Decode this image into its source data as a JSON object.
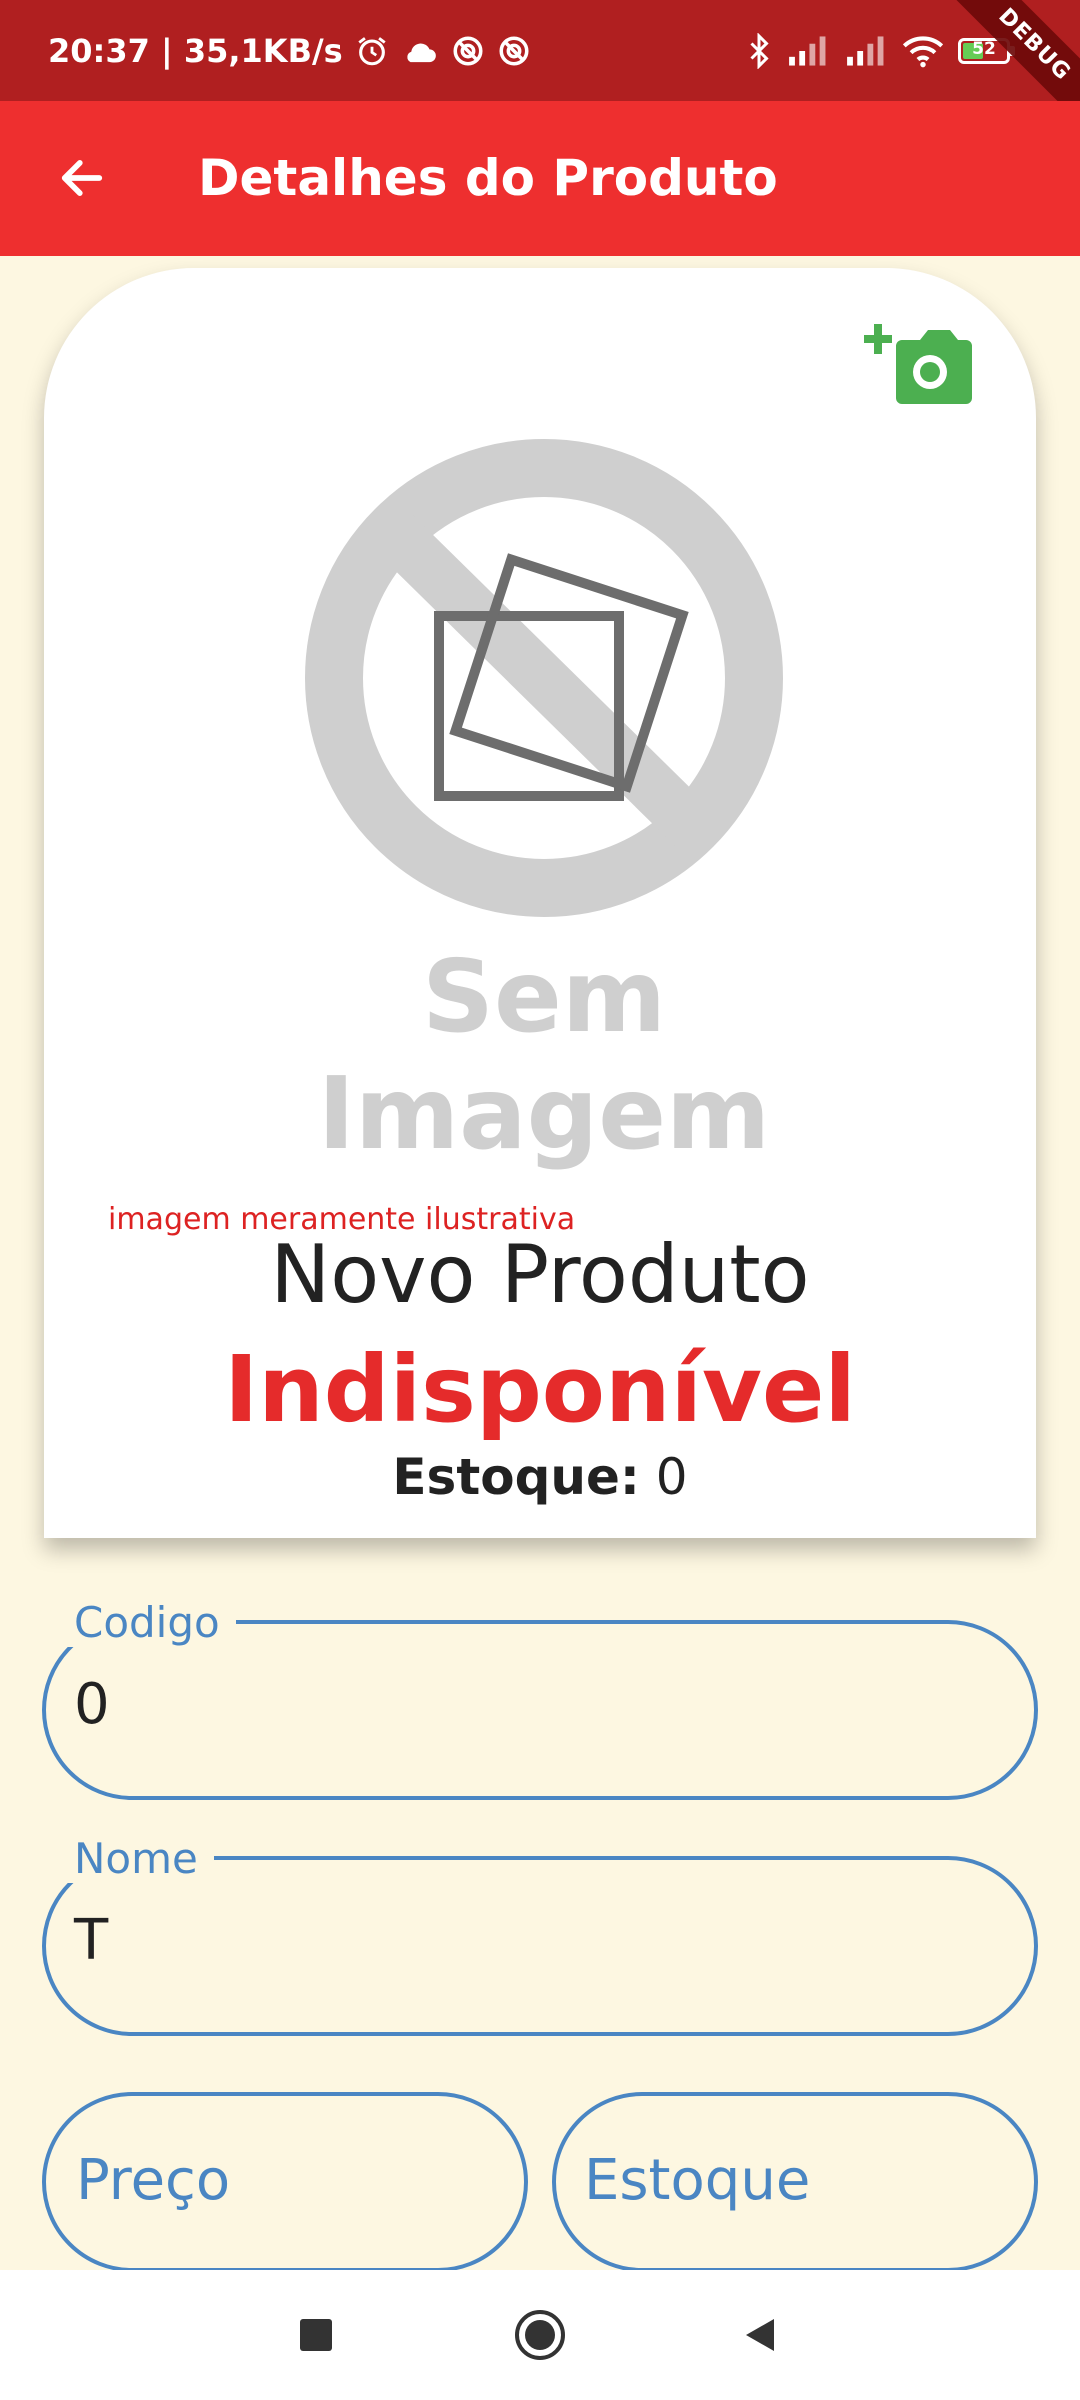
{
  "status_bar": {
    "time_speed": "20:37 | 35,1KB/s",
    "battery_level": "52",
    "battery_fraction": 0.52,
    "debug_label": "DEBUG"
  },
  "app_bar": {
    "title": "Detalhes do Produto",
    "back_icon": "arrow-left-icon"
  },
  "product": {
    "add_photo_icon": "add-a-photo-icon",
    "placeholder_text": "Sem Imagem",
    "illustrative_note": "imagem meramente ilustrativa",
    "name": "Novo Produto",
    "availability": "Indisponível",
    "stock_label": "Estoque:",
    "stock_value": "0"
  },
  "form": {
    "codigo": {
      "label": "Codigo",
      "value": "0"
    },
    "nome": {
      "label": "Nome",
      "value": "T"
    },
    "preco": {
      "label": "Preço"
    },
    "estoque": {
      "label": "Estoque"
    }
  },
  "colors": {
    "status_bar": "#b01f20",
    "app_bar": "#ee2f2f",
    "accent_blue": "#4a86c3",
    "availability_red": "#e52b2b",
    "camera_green": "#4caf50",
    "background": "#fdf7e1"
  }
}
